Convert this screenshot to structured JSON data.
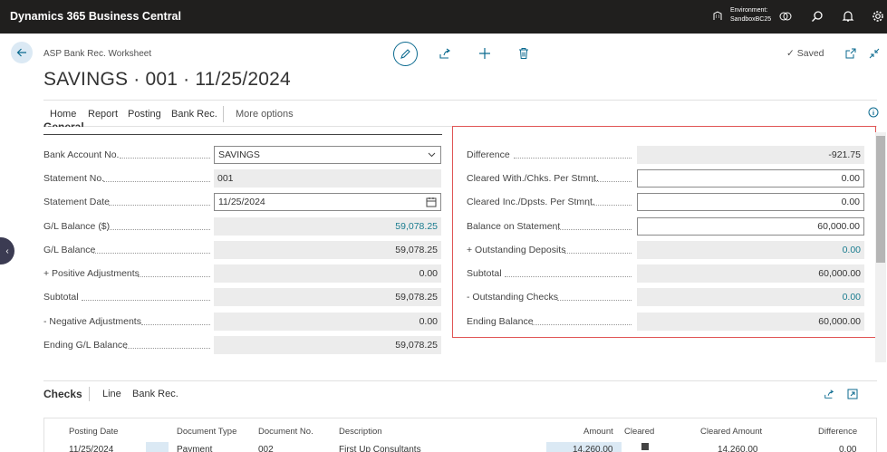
{
  "app": {
    "brand": "Dynamics 365 Business Central",
    "environment_label": "Environment:",
    "environment_name": "SandboxBC25"
  },
  "page": {
    "breadcrumb": "ASP Bank Rec. Worksheet",
    "title": "SAVINGS · 001 · 11/25/2024",
    "saved_label": "Saved"
  },
  "menu": {
    "items": [
      "Home",
      "Report",
      "Posting",
      "Bank Rec."
    ],
    "more": "More options"
  },
  "general": {
    "heading": "General",
    "left_fields": [
      {
        "label": "Bank Account No.",
        "value": "SAVINGS"
      },
      {
        "label": "Statement No.",
        "value": "001"
      },
      {
        "label": "Statement Date",
        "value": "11/25/2024"
      },
      {
        "label": "G/L Balance ($)",
        "value": "59,078.25"
      },
      {
        "label": "G/L Balance",
        "value": "59,078.25"
      },
      {
        "label": "+ Positive Adjustments",
        "value": "0.00"
      },
      {
        "label": "Subtotal",
        "value": "59,078.25"
      },
      {
        "label": "- Negative Adjustments",
        "value": "0.00"
      },
      {
        "label": "Ending G/L Balance",
        "value": "59,078.25"
      }
    ],
    "right_fields": [
      {
        "label": "Difference",
        "value": "-921.75"
      },
      {
        "label": "Cleared With./Chks. Per Stmnt.",
        "value": "0.00"
      },
      {
        "label": "Cleared Inc./Dpsts. Per Stmnt.",
        "value": "0.00"
      },
      {
        "label": "Balance on Statement",
        "value": "60,000.00"
      },
      {
        "label": "+ Outstanding Deposits",
        "value": "0.00"
      },
      {
        "label": "Subtotal",
        "value": "60,000.00"
      },
      {
        "label": "- Outstanding Checks",
        "value": "0.00"
      },
      {
        "label": "Ending Balance",
        "value": "60,000.00"
      }
    ]
  },
  "checks": {
    "title": "Checks",
    "actions": [
      "Line",
      "Bank Rec."
    ],
    "columns": [
      "Posting Date",
      "Document Type",
      "Document No.",
      "Description",
      "Amount",
      "Cleared",
      "Cleared Amount",
      "Difference"
    ],
    "rows": [
      {
        "posting_date": "11/25/2024",
        "document_type": "Payment",
        "document_no": "002",
        "description": "First Up Consultants",
        "amount": "14,260.00",
        "cleared_amount": "14,260.00",
        "difference": "0.00"
      }
    ]
  },
  "colors": {
    "topbar": "#201f1e",
    "accent": "#0b6a8f",
    "link_value": "#1a7c8f",
    "highlight_border": "#e05555"
  }
}
